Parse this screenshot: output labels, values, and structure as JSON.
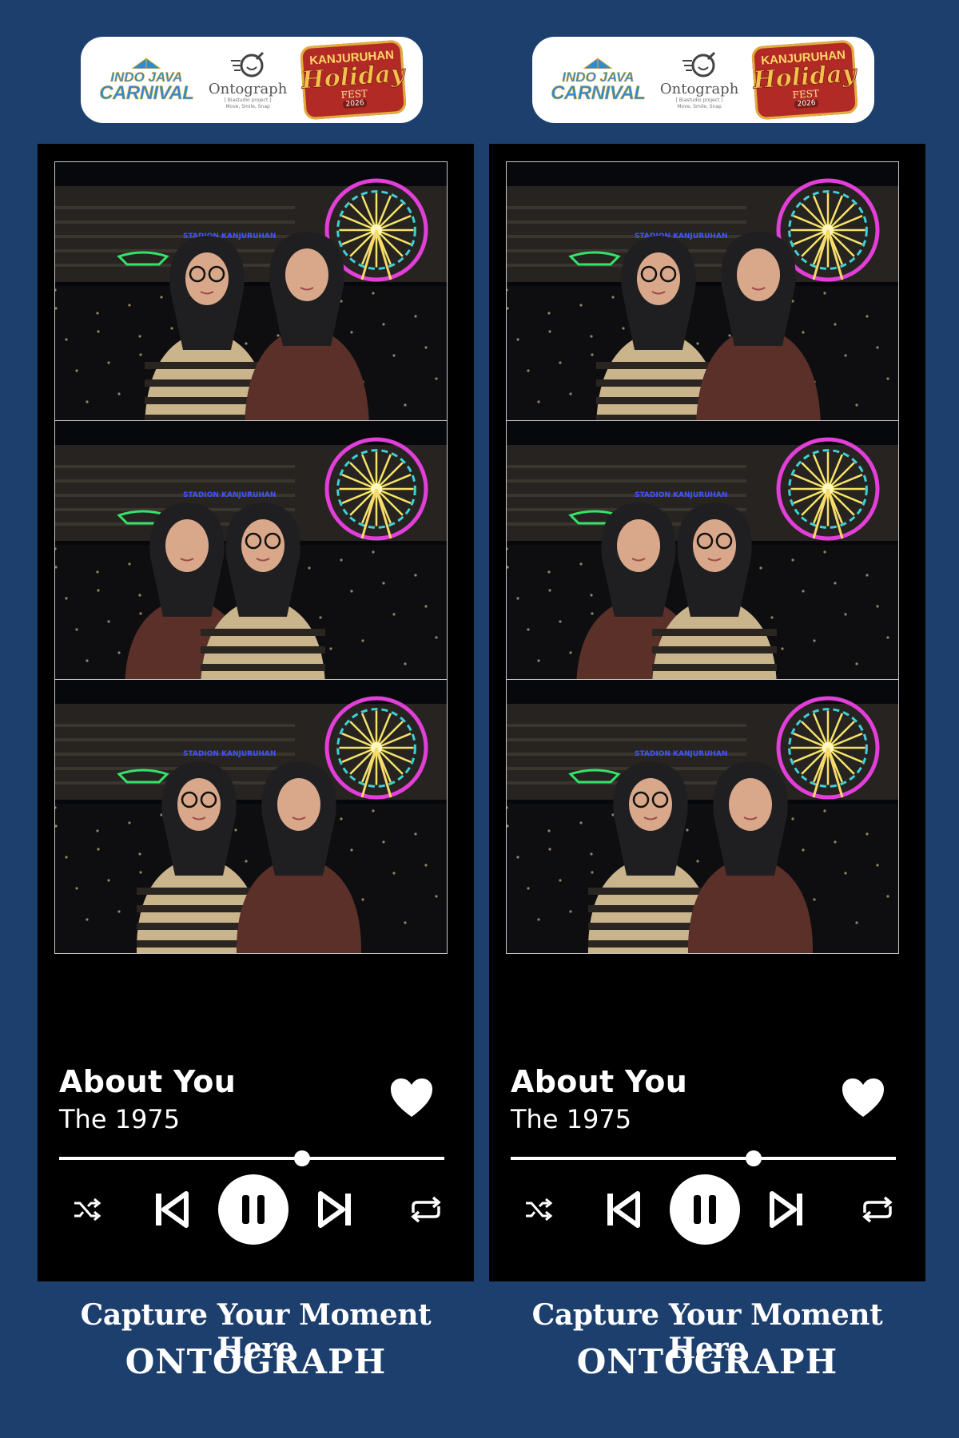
{
  "header_logos": {
    "indo_java_carnival": {
      "line1": "INDO JAVA",
      "line2": "CARNIVAL"
    },
    "ontograph": {
      "name": "Ontograph",
      "sub1": "[ Biastudio project ]",
      "sub2": "Move, Smile, Snap"
    },
    "kanjuruhan": {
      "line1": "KANJURUHAN",
      "line2": "Holiday",
      "line3": "FEST",
      "year": "2026"
    }
  },
  "photos": {
    "venue_sign": "STADION KANJURUHAN"
  },
  "player": {
    "song_title": "About You",
    "artist": "The 1975",
    "progress": 0.63,
    "icons": [
      "heart-icon",
      "shuffle-icon",
      "previous-icon",
      "pause-icon",
      "next-icon",
      "repeat-icon"
    ]
  },
  "footer": {
    "tagline": "Capture Your Moment Here",
    "brand": "ONTOGRAPH"
  },
  "colors": {
    "background": "#1c3f6e",
    "card": "#000000",
    "ferris_pink": "#e23fd8",
    "ferris_cyan": "#3fd1d8",
    "ferris_yellow": "#f5e36a"
  }
}
